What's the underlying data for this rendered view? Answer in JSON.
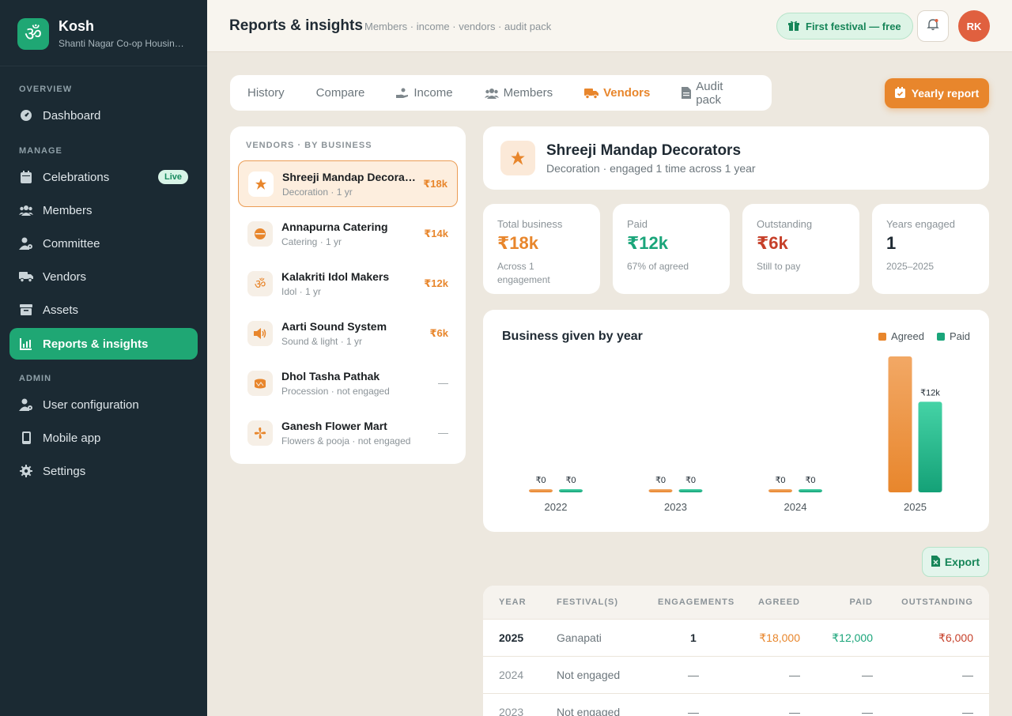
{
  "app": {
    "logo_glyph": "ॐ",
    "name": "Kosh",
    "society": "Shanti Nagar Co-op Housing Society"
  },
  "sidebar": {
    "sections": {
      "overview": "OVERVIEW",
      "manage": "MANAGE",
      "admin": "ADMIN"
    },
    "items": [
      {
        "label": "Dashboard",
        "icon": "dashboard-icon"
      },
      {
        "label": "Celebrations",
        "icon": "calendar-icon",
        "badge": "Live"
      },
      {
        "label": "Members",
        "icon": "users-icon"
      },
      {
        "label": "Committee",
        "icon": "user-gear-icon"
      },
      {
        "label": "Vendors",
        "icon": "truck-icon"
      },
      {
        "label": "Assets",
        "icon": "archive-icon"
      },
      {
        "label": "Reports & insights",
        "icon": "chart-icon",
        "active": true
      },
      {
        "label": "User configuration",
        "icon": "user-gear-icon"
      },
      {
        "label": "Mobile app",
        "icon": "mobile-icon"
      },
      {
        "label": "Settings",
        "icon": "gear-icon"
      }
    ]
  },
  "header": {
    "title": "Reports & insights",
    "subtitle": "Members · income · vendors · audit pack",
    "promo": "First festival — free",
    "avatar_initials": "RK"
  },
  "tabs": [
    {
      "label": "History"
    },
    {
      "label": "Compare"
    },
    {
      "label": "Income"
    },
    {
      "label": "Members"
    },
    {
      "label": "Vendors",
      "active": true
    },
    {
      "label": "Audit pack"
    }
  ],
  "actions": {
    "yearly_report": "Yearly report",
    "export": "Export"
  },
  "vendor_list": {
    "heading": "VENDORS · BY BUSINESS",
    "items": [
      {
        "name": "Shreeji Mandap Decorators",
        "sub": "Decoration · 1 yr",
        "amount": "₹18k",
        "selected": true
      },
      {
        "name": "Annapurna Catering",
        "sub": "Catering · 1 yr",
        "amount": "₹14k"
      },
      {
        "name": "Kalakriti Idol Makers",
        "sub": "Idol · 1 yr",
        "amount": "₹12k"
      },
      {
        "name": "Aarti Sound System",
        "sub": "Sound & light · 1 yr",
        "amount": "₹6k"
      },
      {
        "name": "Dhol Tasha Pathak",
        "sub": "Procession · not engaged",
        "amount": "—"
      },
      {
        "name": "Ganesh Flower Mart",
        "sub": "Flowers & pooja · not engaged",
        "amount": "—"
      }
    ]
  },
  "vendor_detail": {
    "name": "Shreeji Mandap Decorators",
    "sub": "Decoration · engaged 1 time across 1 year"
  },
  "stats": [
    {
      "label": "Total business",
      "value": "₹18k",
      "note": "Across 1 engagement",
      "color": "#e8862c"
    },
    {
      "label": "Paid",
      "value": "₹12k",
      "note": "67% of agreed",
      "color": "#1aa57a"
    },
    {
      "label": "Outstanding",
      "value": "₹6k",
      "note": "Still to pay",
      "color": "#c6402a"
    },
    {
      "label": "Years engaged",
      "value": "1",
      "note": "2025–2025",
      "color": "#1f2a33"
    }
  ],
  "chart_data": {
    "type": "bar",
    "title": "Business given by year",
    "categories": [
      "2022",
      "2023",
      "2024",
      "2025"
    ],
    "series": [
      {
        "name": "Agreed",
        "values": [
          0,
          0,
          0,
          18000
        ],
        "labels": [
          "₹0",
          "₹0",
          "₹0",
          ""
        ],
        "color": "#e8862c"
      },
      {
        "name": "Paid",
        "values": [
          0,
          0,
          0,
          12000
        ],
        "labels": [
          "₹0",
          "₹0",
          "₹0",
          "₹12k"
        ],
        "color": "#1aa57a"
      }
    ],
    "legend_position": "top-right",
    "grid": false
  },
  "table": {
    "columns": [
      "YEAR",
      "FESTIVAL(S)",
      "ENGAGEMENTS",
      "AGREED",
      "PAID",
      "OUTSTANDING"
    ],
    "rows": [
      {
        "year": "2025",
        "festival": "Ganapati",
        "engagements": "1",
        "agreed": "₹18,000",
        "paid": "₹12,000",
        "outstanding": "₹6,000"
      },
      {
        "year": "2024",
        "festival": "Not engaged",
        "engagements": "—",
        "agreed": "—",
        "paid": "—",
        "outstanding": "—"
      },
      {
        "year": "2023",
        "festival": "Not engaged",
        "engagements": "—",
        "agreed": "—",
        "paid": "—",
        "outstanding": "—"
      }
    ]
  }
}
